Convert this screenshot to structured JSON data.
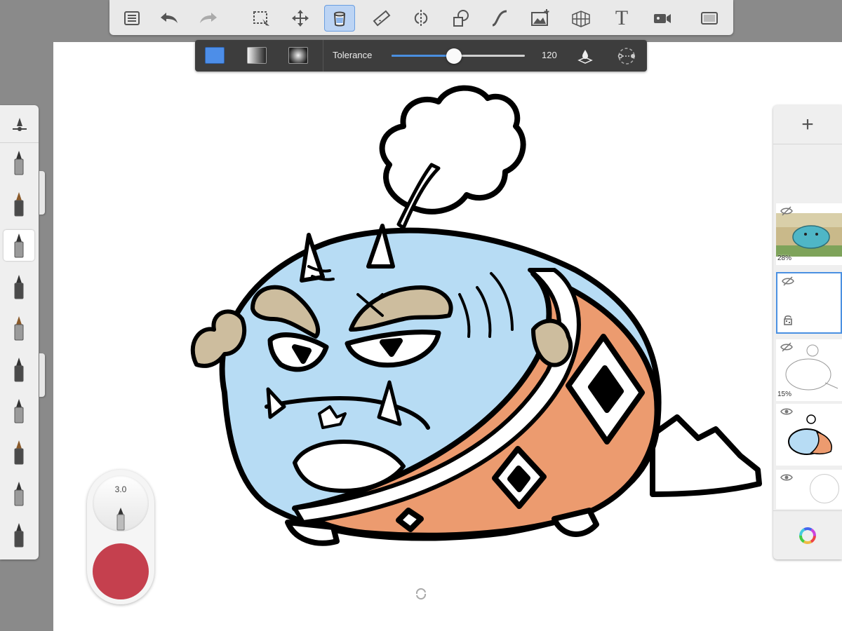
{
  "app": {
    "toolbar": {
      "active_tool": "fill",
      "tools": [
        {
          "id": "layers-list",
          "icon": "list-icon"
        },
        {
          "id": "undo",
          "icon": "undo-icon"
        },
        {
          "id": "redo",
          "icon": "redo-icon"
        },
        {
          "id": "selection",
          "icon": "selection-icon"
        },
        {
          "id": "transform",
          "icon": "transform-icon"
        },
        {
          "id": "fill",
          "icon": "paint-bucket-icon"
        },
        {
          "id": "ruler",
          "icon": "ruler-icon"
        },
        {
          "id": "symmetry",
          "icon": "symmetry-icon"
        },
        {
          "id": "shape",
          "icon": "shape-icon"
        },
        {
          "id": "curve",
          "icon": "curve-icon"
        },
        {
          "id": "image",
          "icon": "image-add-icon"
        },
        {
          "id": "perspective",
          "icon": "perspective-grid-icon"
        },
        {
          "id": "text",
          "icon": "text-icon"
        },
        {
          "id": "record",
          "icon": "video-camera-icon"
        },
        {
          "id": "fullscreen",
          "icon": "fullscreen-icon"
        }
      ],
      "text_tool_glyph": "T"
    },
    "fill_options": {
      "modes": [
        "solid",
        "linear-gradient",
        "radial-gradient"
      ],
      "active_mode": "solid",
      "solid_color": "#4d8ee8",
      "tolerance_label": "Tolerance",
      "tolerance_value": "120",
      "tolerance_fraction": 0.47
    },
    "brush_panel": {
      "active_index": 2,
      "brushes": [
        "pencil",
        "marker",
        "airbrush",
        "ink-bottle",
        "fineliner",
        "grease-pencil",
        "fountain-pen",
        "paint-brush",
        "dry-brush",
        "chisel"
      ]
    },
    "brush_puck": {
      "size": "3.0",
      "color": "#c5404e"
    },
    "layers": {
      "add_label": "+",
      "active_index": 1,
      "items": [
        {
          "name": "background-scene",
          "visible": false,
          "opacity": "28%"
        },
        {
          "name": "empty-layer",
          "visible": false,
          "opacity": "",
          "locked": true
        },
        {
          "name": "sketch-lines",
          "visible": false,
          "opacity": "15%"
        },
        {
          "name": "colored-drawing",
          "visible": true,
          "opacity": ""
        },
        {
          "name": "base-layer",
          "visible": true,
          "opacity": ""
        }
      ]
    },
    "colors": {
      "body_blue": "#b7dcf4",
      "robe_orange": "#ec9b6f",
      "hair_tan": "#cdbd9e",
      "accent": "#4a90e2"
    }
  }
}
